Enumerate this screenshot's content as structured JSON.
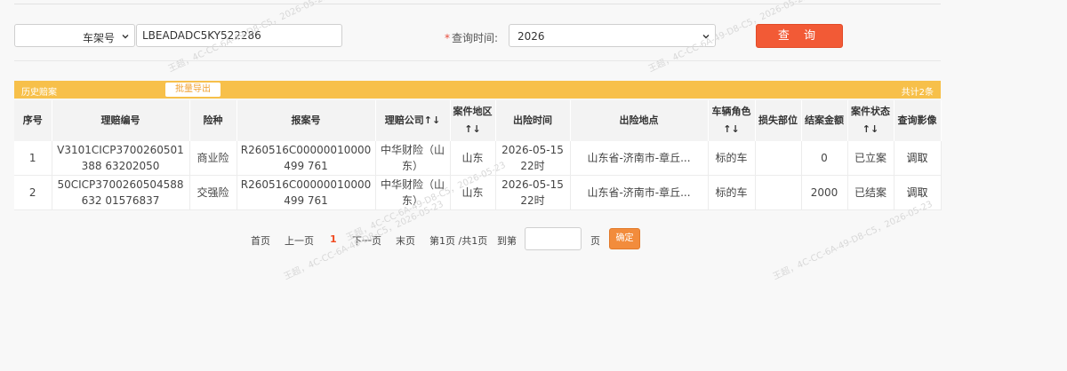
{
  "search": {
    "type_select": "车架号",
    "vin_value": "LBEADADC5KY522286",
    "time_required_mark": "*",
    "time_label": "查询时间:",
    "time_select": "2026",
    "query_button": "查 询"
  },
  "results": {
    "title": "历史赔案",
    "export_button": "批量导出",
    "total": "共计2条",
    "headers": [
      "序号",
      "理赔编号",
      "险种",
      "报案号",
      "理赔公司↑↓",
      "案件地区↑↓",
      "出险时间",
      "出险地点",
      "车辆角色↑↓",
      "损失部位",
      "结案金额",
      "案件状态↑↓",
      "查询影像"
    ],
    "rows": [
      [
        "1",
        "V3101CICP3700260501388 63202050",
        "商业险",
        "R260516C00000010000499 761",
        "中华财险（山东）",
        "山东",
        "2026-05-15 22时",
        "山东省-济南市-章丘...",
        "标的车",
        "",
        "0",
        "已立案",
        "调取"
      ],
      [
        "2",
        "50CICP3700260504588632 01576837",
        "交强险",
        "R260516C00000010000499 761",
        "中华财险（山东）",
        "山东",
        "2026-05-15 22时",
        "山东省-济南市-章丘...",
        "标的车",
        "",
        "2000",
        "已结案",
        "调取"
      ]
    ]
  },
  "pager": {
    "first": "首页",
    "prev": "上一页",
    "current": "1",
    "next": "下一页",
    "last": "末页",
    "info": "第1页 /共1页",
    "goto_label": "到第",
    "goto_value": "",
    "page_suffix": "页",
    "confirm": "确定"
  },
  "watermark": "王超，4C-CC-6A-49-D8-C5，2026-05-23",
  "colors": {
    "query_button": "#f25a36",
    "result_bar": "#f7c04a",
    "confirm_button": "#f28c3c",
    "current_page": "#f04a20"
  }
}
